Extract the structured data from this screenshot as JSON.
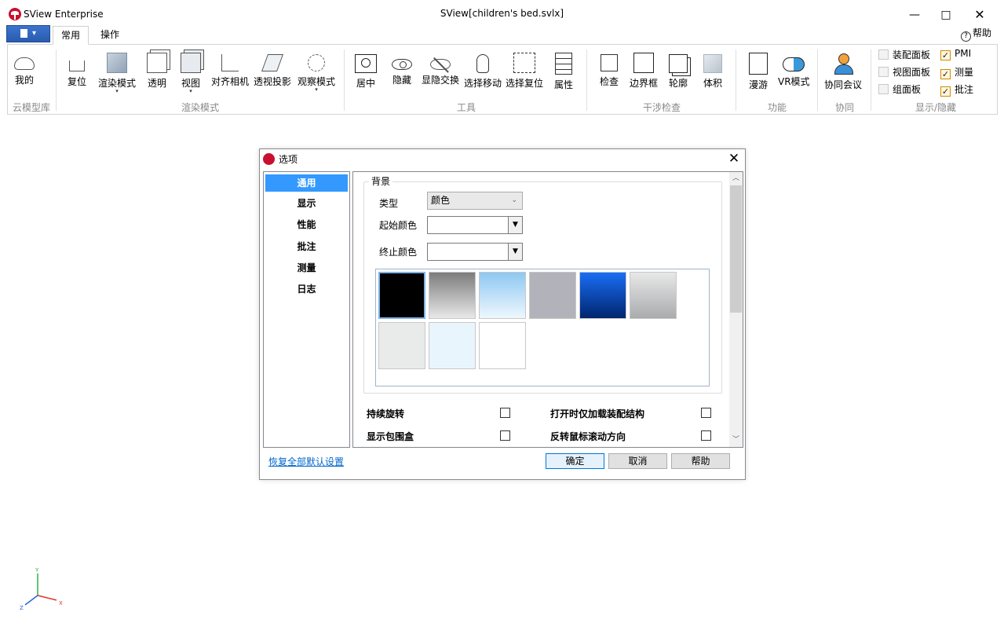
{
  "window": {
    "app_name": "SView Enterprise",
    "doc_title": "SView[children's bed.svlx]",
    "min": "—",
    "max": "□",
    "close": "✕"
  },
  "tabs": {
    "active": "常用",
    "ops": "操作",
    "help": "帮助"
  },
  "ribbon": {
    "groups": {
      "cloud": "云模型库",
      "render": "渲染模式",
      "tools": "工具",
      "interference": "干涉检查",
      "func": "功能",
      "collab": "协同",
      "showhide": "显示/隐藏"
    },
    "buttons": {
      "mine": "我的",
      "reset": "复位",
      "render_mode": "渲染模式",
      "transparent": "透明",
      "view": "视图",
      "align_camera": "对齐相机",
      "perspective": "透视投影",
      "observe": "观察模式",
      "center": "居中",
      "hide": "隐藏",
      "swap_hide": "显隐交换",
      "select_move": "选择移动",
      "select_reset": "选择复位",
      "property": "属性",
      "check": "检查",
      "bbox": "边界框",
      "outline": "轮廓",
      "volume": "体积",
      "walk": "漫游",
      "vr": "VR模式",
      "meeting": "协同会议"
    },
    "checks": {
      "assembly_panel": "装配面板",
      "view_panel": "视图面板",
      "group_panel": "组面板",
      "pmi": "PMI",
      "measure": "测量",
      "annotation": "批注"
    },
    "checkmark": "✓",
    "dropdown_mark": "▾"
  },
  "dialog": {
    "title": "选项",
    "close": "✕",
    "nav": [
      "通用",
      "显示",
      "性能",
      "批注",
      "测量",
      "日志"
    ],
    "background": {
      "legend": "背景",
      "type_label": "类型",
      "type_value": "颜色",
      "start_color_label": "起始颜色",
      "end_color_label": "终止颜色",
      "arrow": "▼",
      "combo_arrow": "⌄"
    },
    "options": {
      "continuous_rotate": "持续旋转",
      "load_assembly_only": "打开时仅加载装配结构",
      "show_bbox": "显示包围盒",
      "invert_wheel": "反转鼠标滚动方向"
    },
    "restore_defaults": "恢复全部默认设置",
    "ok": "确定",
    "cancel": "取消",
    "help": "帮助",
    "scroll_up": "︿",
    "scroll_down": "﹀"
  },
  "axis": {
    "x": "X",
    "y": "Y",
    "z": "Z"
  }
}
